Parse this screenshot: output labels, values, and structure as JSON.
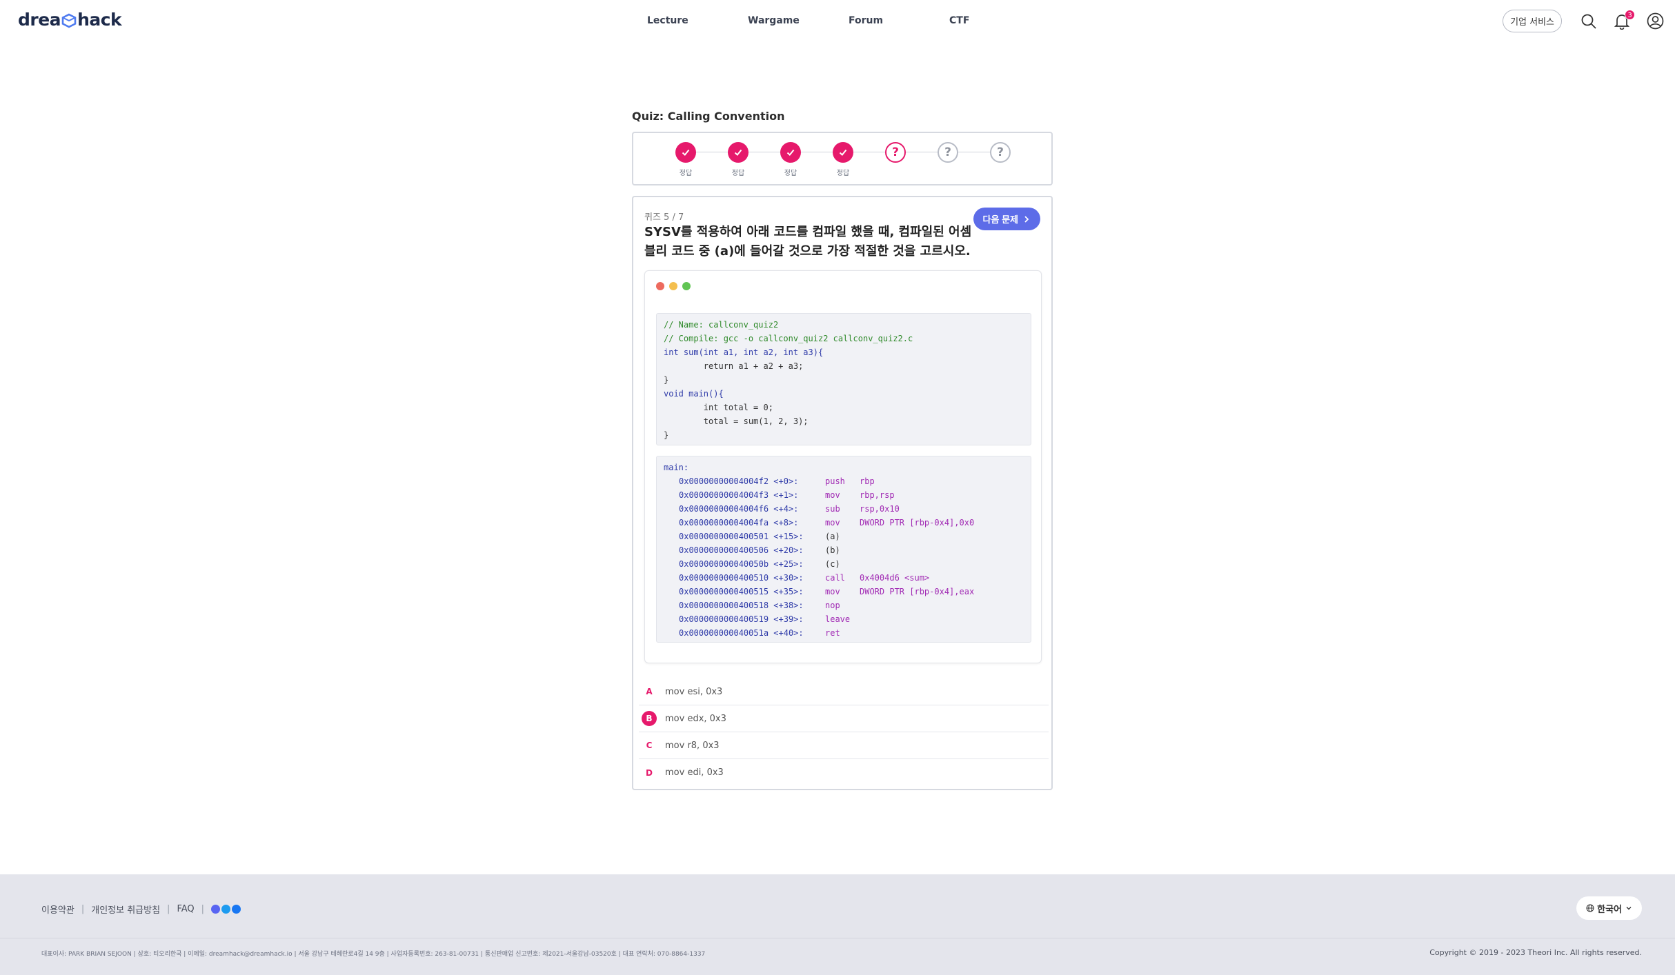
{
  "brand": {
    "logo_left": "drea",
    "logo_right": "hack"
  },
  "nav": [
    {
      "label": "Lecture"
    },
    {
      "label": "Wargame"
    },
    {
      "label": "Forum"
    },
    {
      "label": "CTF"
    }
  ],
  "header": {
    "business_label": "기업 서비스",
    "notification_count": "3"
  },
  "quiz": {
    "title": "Quiz: Calling Convention",
    "steps": [
      {
        "state": "done",
        "label": "정답"
      },
      {
        "state": "done",
        "label": "정답"
      },
      {
        "state": "done",
        "label": "정답"
      },
      {
        "state": "done",
        "label": "정답"
      },
      {
        "state": "current",
        "label": ""
      },
      {
        "state": "todo",
        "label": ""
      },
      {
        "state": "todo",
        "label": ""
      }
    ],
    "question_number": "퀴즈 5 / 7",
    "question": "SYSV를 적용하여 아래 코드를 컴파일 했을 때, 컴파일된 어셈블리 코드 중 (a)에 들어갈 것으로 가장 적절한 것을 고르시오.",
    "next_label": "다음 문제",
    "source_code": [
      "// Name: callconv_quiz2",
      "// Compile: gcc -o callconv_quiz2 callconv_quiz2.c",
      "int sum(int a1, int a2, int a3){",
      "        return a1 + a2 + a3;",
      "}",
      "void main(){",
      "        int total = 0;",
      "        total = sum(1, 2, 3);",
      "}"
    ],
    "asm_header": "main:",
    "asm": [
      {
        "addr": "0x00000000004004f2 <+0>:",
        "op": "push",
        "args": "rbp"
      },
      {
        "addr": "0x00000000004004f3 <+1>:",
        "op": "mov",
        "args": "rbp,rsp"
      },
      {
        "addr": "0x00000000004004f6 <+4>:",
        "op": "sub",
        "args": "rsp,0x10"
      },
      {
        "addr": "0x00000000004004fa <+8>:",
        "op": "mov",
        "args": "DWORD PTR [rbp-0x4],0x0"
      },
      {
        "addr": "0x0000000000400501 <+15>:",
        "op": "(a)",
        "args": ""
      },
      {
        "addr": "0x0000000000400506 <+20>:",
        "op": "(b)",
        "args": ""
      },
      {
        "addr": "0x000000000040050b <+25>:",
        "op": "(c)",
        "args": ""
      },
      {
        "addr": "0x0000000000400510 <+30>:",
        "op": "call",
        "args": "0x4004d6 <sum>"
      },
      {
        "addr": "0x0000000000400515 <+35>:",
        "op": "mov",
        "args": "DWORD PTR [rbp-0x4],eax"
      },
      {
        "addr": "0x0000000000400518 <+38>:",
        "op": "nop",
        "args": ""
      },
      {
        "addr": "0x0000000000400519 <+39>:",
        "op": "leave",
        "args": ""
      },
      {
        "addr": "0x000000000040051a <+40>:",
        "op": "ret",
        "args": ""
      }
    ],
    "choices": [
      {
        "letter": "A",
        "text": "mov esi, 0x3",
        "selected": false
      },
      {
        "letter": "B",
        "text": "mov edx, 0x3",
        "selected": true
      },
      {
        "letter": "C",
        "text": "mov r8, 0x3",
        "selected": false
      },
      {
        "letter": "D",
        "text": "mov edi, 0x3",
        "selected": false
      }
    ]
  },
  "footer": {
    "links": [
      "이용약관",
      "개인정보 취급방침",
      "FAQ"
    ],
    "language": "한국어",
    "info": "대표이사: PARK BRIAN SEJOON | 상호: 티오리한국 | 이메일: dreamhack@dreamhack.io | 서울 강남구 테헤란로4길 14 9층 | 사업자등록번호: 263-81-00731 | 통신판매업 신고번호: 제2021-서울강남-03520호 | 대표 연락처: 070-8864-1337",
    "copyright": "Copyright © 2019 - 2023 Theori Inc. All rights reserved."
  },
  "colors": {
    "accent": "#e6196b",
    "primary_button": "#5d6ce8",
    "footer_bg": "#e4e5ec"
  }
}
